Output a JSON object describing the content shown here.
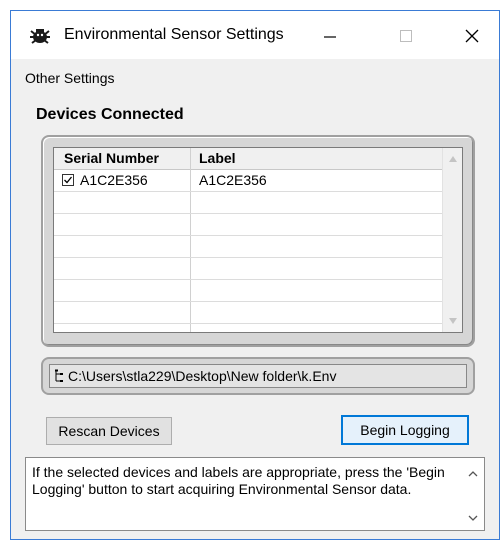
{
  "window": {
    "title": "Environmental Sensor Settings",
    "controls": {
      "minimize": "—",
      "maximize": "☐",
      "close": "✕"
    },
    "accent_color": "#0078d7"
  },
  "menu": {
    "other_settings": "Other Settings"
  },
  "devices": {
    "heading": "Devices Connected",
    "columns": {
      "serial": "Serial Number",
      "label": "Label"
    },
    "rows": [
      {
        "checked": true,
        "checkmark": "✓",
        "serial": "A1C2E356",
        "label": "A1C2E356"
      }
    ]
  },
  "file_path": "C:\\Users\\stla229\\Desktop\\New folder\\k.Env",
  "buttons": {
    "rescan": "Rescan Devices",
    "begin_logging": "Begin Logging"
  },
  "message": "If the selected devices and labels are appropriate, press the 'Begin Logging' button to start acquiring Environmental Sensor data.",
  "icons": {
    "app": "bug-icon",
    "path": "tree-icon",
    "scroll_up": "▲",
    "scroll_down": "▼",
    "msg_up": "⌃",
    "msg_down": "⌄"
  }
}
